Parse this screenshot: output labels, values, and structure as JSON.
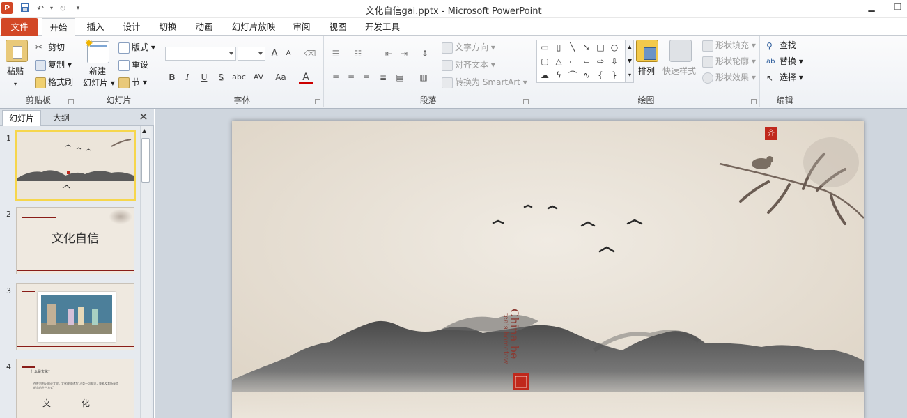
{
  "window": {
    "title": "文化自信gai.pptx - Microsoft PowerPoint",
    "app_logo": "P"
  },
  "tabs": [
    "文件",
    "开始",
    "插入",
    "设计",
    "切换",
    "动画",
    "幻灯片放映",
    "审阅",
    "视图",
    "开发工具"
  ],
  "ribbon": {
    "clipboard": {
      "paste": "粘贴",
      "cut": "剪切",
      "copy": "复制",
      "format_painter": "格式刷",
      "label": "剪贴板"
    },
    "slides": {
      "new_slide_1": "新建",
      "new_slide_2": "幻灯片",
      "layout": "版式",
      "reset": "重设",
      "section": "节",
      "label": "幻灯片"
    },
    "font": {
      "bold": "B",
      "italic": "I",
      "underline": "U",
      "shadow": "S",
      "strike": "abc",
      "spacing": "AV",
      "case": "Aa",
      "color": "A",
      "grow": "A",
      "shrink": "A",
      "label": "字体"
    },
    "paragraph": {
      "text_direction": "文字方向",
      "align_text": "对齐文本",
      "smartart": "转换为 SmartArt",
      "label": "段落"
    },
    "drawing": {
      "arrange": "排列",
      "quick_styles": "快速样式",
      "shape_fill": "形状填充",
      "shape_outline": "形状轮廓",
      "shape_effects": "形状效果",
      "label": "绘图"
    },
    "editing": {
      "find": "查找",
      "replace": "替换",
      "select": "选择",
      "label": "编辑"
    }
  },
  "pane": {
    "tab_slides": "幻灯片",
    "tab_outline": "大纲"
  },
  "thumbnails": [
    {
      "num": "1"
    },
    {
      "num": "2",
      "title": "文化自信"
    },
    {
      "num": "3"
    },
    {
      "num": "4",
      "heading": "什么是文化?",
      "body": "在胜利书记的论文里，文化被描述为“人类一切知识，技能及其所获得的总的生产方式”",
      "glyph_1": "文",
      "glyph_2": "化"
    }
  ],
  "slide": {
    "vertical_text_1": "China be",
    "vertical_text_2": "tea's hometow",
    "seal_char": "齐"
  },
  "colors": {
    "file_tab": "#d24726",
    "selected_thumb": "#f6d64c",
    "paper": "#ece5da",
    "ink": "#3a3a3a",
    "seal": "#c0281c"
  }
}
